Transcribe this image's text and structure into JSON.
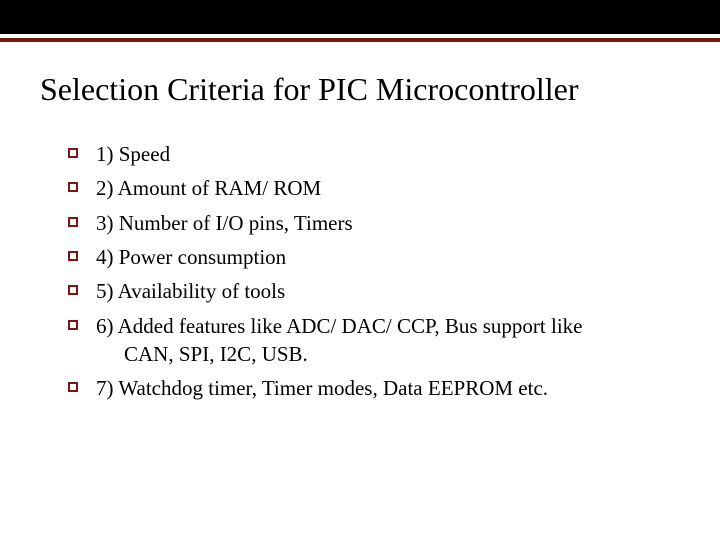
{
  "title": "Selection Criteria for PIC Microcontroller",
  "items": [
    {
      "text": "1) Speed"
    },
    {
      "text": "2) Amount of RAM/ ROM"
    },
    {
      "text": "3) Number of I/O pins, Timers"
    },
    {
      "text": "4) Power consumption"
    },
    {
      "text": "5) Availability of tools"
    },
    {
      "text": "6) Added features like ADC/ DAC/ CCP, Bus support like",
      "continuation": "CAN, SPI, I2C, USB."
    },
    {
      "text": "7) Watchdog timer, Timer modes, Data EEPROM etc."
    }
  ]
}
